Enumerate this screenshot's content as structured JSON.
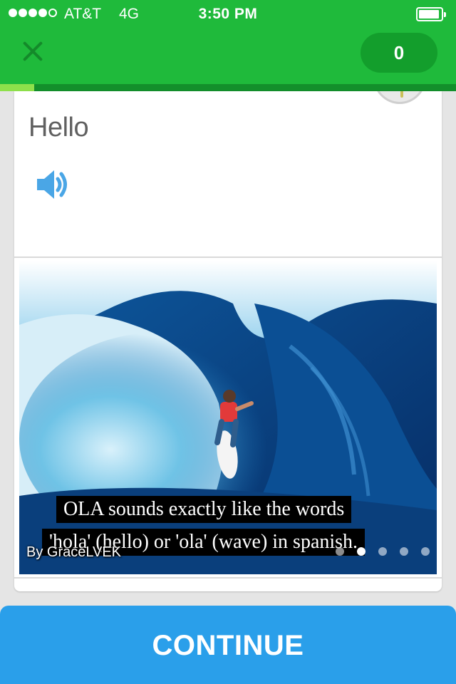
{
  "status_bar": {
    "carrier": "AT&T",
    "network": "4G",
    "time": "3:50 PM",
    "signal_bars": 4,
    "signal_total": 5,
    "battery_icon": "battery-icon"
  },
  "header": {
    "close_icon": "close-icon",
    "score": "0",
    "lesson_progress": 0.075
  },
  "prompt": {
    "word": "Hello",
    "audio_icon": "speaker-icon"
  },
  "image": {
    "subtitle_line1": "OLA sounds exactly like the words",
    "subtitle_line2": "'hola' (hello) or 'ola' (wave) in spanish.",
    "credit": "By GraceLVEK",
    "pager_total": 5,
    "pager_active": 2
  },
  "actions": {
    "continue_label": "CONTINUE"
  },
  "colors": {
    "header_green": "#1fba3b",
    "button_blue": "#2a9fea"
  }
}
